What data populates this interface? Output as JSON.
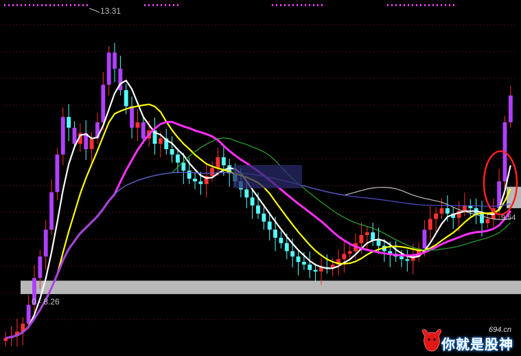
{
  "chart_data": {
    "type": "candlestick",
    "price_range": [
      7.3,
      13.6
    ],
    "high_label": "13.31",
    "low_label": "0 - 8.26",
    "right_label": "9.54",
    "highlight_band_price": [
      8.3,
      8.55
    ],
    "up_color": "#ff3030",
    "down_color": "#54ffff",
    "volume_bar_color": "#b040ff",
    "ma_series": [
      {
        "color": "#ffffff",
        "period": 5
      },
      {
        "color": "#ffff00",
        "period": 10
      },
      {
        "color": "#ff30ff",
        "period": 20
      },
      {
        "color": "#2ea82e",
        "period": 30
      },
      {
        "color": "#c0c0c0",
        "period": 60
      },
      {
        "color": "#5050d0",
        "period": 120
      }
    ],
    "close": [
      7.48,
      7.52,
      7.6,
      7.75,
      8.1,
      8.6,
      9.0,
      9.5,
      10.2,
      10.9,
      11.6,
      11.4,
      11.1,
      11.3,
      11.0,
      11.2,
      11.5,
      12.2,
      12.8,
      12.5,
      12.1,
      11.8,
      11.4,
      11.5,
      11.2,
      11.35,
      11.1,
      11.2,
      11.0,
      10.9,
      10.75,
      10.6,
      10.45,
      10.4,
      10.35,
      10.5,
      10.65,
      10.85,
      10.7,
      10.55,
      10.4,
      10.25,
      10.1,
      9.95,
      9.8,
      9.65,
      9.5,
      9.35,
      9.25,
      9.1,
      9.0,
      8.9,
      8.85,
      8.75,
      8.72,
      8.8,
      8.78,
      8.85,
      8.95,
      9.05,
      9.1,
      9.25,
      9.4,
      9.45,
      9.3,
      9.2,
      9.1,
      9.05,
      9.0,
      8.95,
      8.92,
      9.0,
      9.15,
      9.5,
      9.7,
      9.8,
      9.9,
      9.8,
      9.72,
      9.85,
      9.95,
      9.9,
      9.8,
      9.62,
      9.7,
      9.9,
      10.4,
      11.5,
      12.0
    ]
  },
  "watermark": {
    "domain": "694.cn",
    "text": "你就是股神"
  }
}
